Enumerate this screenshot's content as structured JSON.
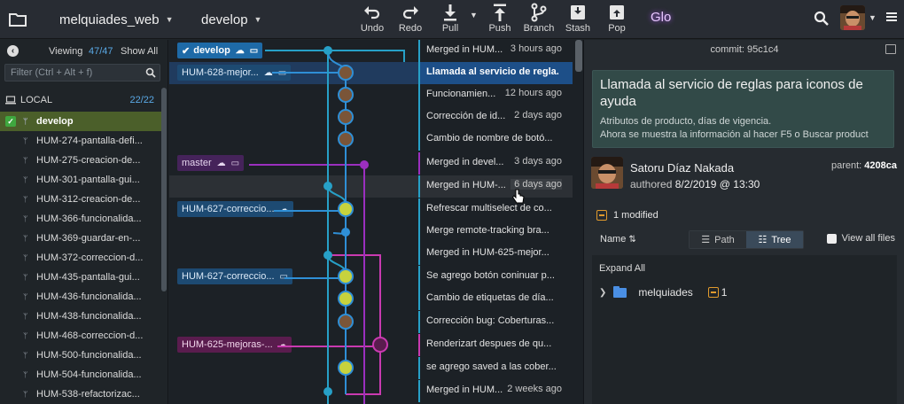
{
  "topbar": {
    "repo": "melquiades_web",
    "branch": "develop",
    "buttons": [
      {
        "label": "Undo",
        "icon": "undo-icon"
      },
      {
        "label": "Redo",
        "icon": "redo-icon"
      },
      {
        "label": "Pull",
        "icon": "pull-icon"
      },
      {
        "label": "Push",
        "icon": "push-icon"
      },
      {
        "label": "Branch",
        "icon": "branch-icon"
      },
      {
        "label": "Stash",
        "icon": "stash-icon"
      },
      {
        "label": "Pop",
        "icon": "pop-icon"
      }
    ],
    "glo": "Glo"
  },
  "left": {
    "viewing_prefix": "Viewing",
    "viewing_count": "47/47",
    "show_all": "Show All",
    "filter_placeholder": "Filter (Ctrl + Alt + f)",
    "local_label": "LOCAL",
    "local_count": "22/22",
    "branches": [
      "develop",
      "HUM-274-pantalla-defi...",
      "HUM-275-creacion-de...",
      "HUM-301-pantalla-gui...",
      "HUM-312-creacion-de...",
      "HUM-366-funcionalida...",
      "HUM-369-guardar-en-...",
      "HUM-372-correccion-d...",
      "HUM-435-pantalla-gui...",
      "HUM-436-funcionalida...",
      "HUM-438-funcionalida...",
      "HUM-468-correccion-d...",
      "HUM-500-funcionalida...",
      "HUM-504-funcionalida...",
      "HUM-538-refactorizac..."
    ]
  },
  "graph": {
    "rows": [
      {
        "msg": "Merged in HUM...",
        "when": "3 hours ago",
        "label": "develop"
      },
      {
        "msg": "Llamada al servicio de regla...",
        "when": "",
        "label": "HUM-628-mejor..."
      },
      {
        "msg": "Funcionamien...",
        "when": "12 hours ago",
        "label": ""
      },
      {
        "msg": "Corrección de id...",
        "when": "2 days ago",
        "label": ""
      },
      {
        "msg": "Cambio de nombre de botó...",
        "when": "",
        "label": ""
      },
      {
        "msg": "Merged in devel...",
        "when": "3 days ago",
        "label": "master"
      },
      {
        "msg": "Merged in HUM-...",
        "when": "6 days ago",
        "label": ""
      },
      {
        "msg": "Refrescar multiselect de co...",
        "when": "",
        "label": "HUM-627-correccio..."
      },
      {
        "msg": "Merge remote-tracking bra...",
        "when": "",
        "label": ""
      },
      {
        "msg": "Merged in HUM-625-mejor...",
        "when": "",
        "label": ""
      },
      {
        "msg": "Se agrego botón coninuar p...",
        "when": "",
        "label": "HUM-627-correccio..."
      },
      {
        "msg": "Cambio de etiquetas de día...",
        "when": "",
        "label": ""
      },
      {
        "msg": "Corrección bug: Coberturas...",
        "when": "",
        "label": ""
      },
      {
        "msg": "Renderizart despues de qu...",
        "when": "",
        "label": "HUM-625-mejoras-..."
      },
      {
        "msg": "se agrego saved a las cober...",
        "when": "",
        "label": ""
      },
      {
        "msg": "Merged in HUM...",
        "when": "2 weeks ago",
        "label": ""
      }
    ]
  },
  "commit": {
    "label": "commit:",
    "sha": "95c1c4",
    "title": "Llamada al servicio de reglas para iconos de ayuda",
    "body_1": "Atributos de producto, días de vigencia.",
    "body_2": "Ahora se muestra la información al hacer F5 o Buscar product",
    "author": "Satoru Díaz Nakada",
    "authored_label": "authored",
    "authored_date": "8/2/2019 @ 13:30",
    "parent_label": "parent:",
    "parent_sha": "4208ca",
    "modified": "1 modified",
    "name_label": "Name",
    "view_path": "Path",
    "view_tree": "Tree",
    "view_all_files": "View all files",
    "expand_all": "Expand All",
    "folder_name": "melquiades",
    "folder_count": "1"
  },
  "colors": {
    "accent": "#2f8fd6",
    "develop_branch": "#1e6aa7",
    "master_lane": "#9b2fbf",
    "magenta_lane": "#c93ab0",
    "message_box": "#324a48"
  }
}
